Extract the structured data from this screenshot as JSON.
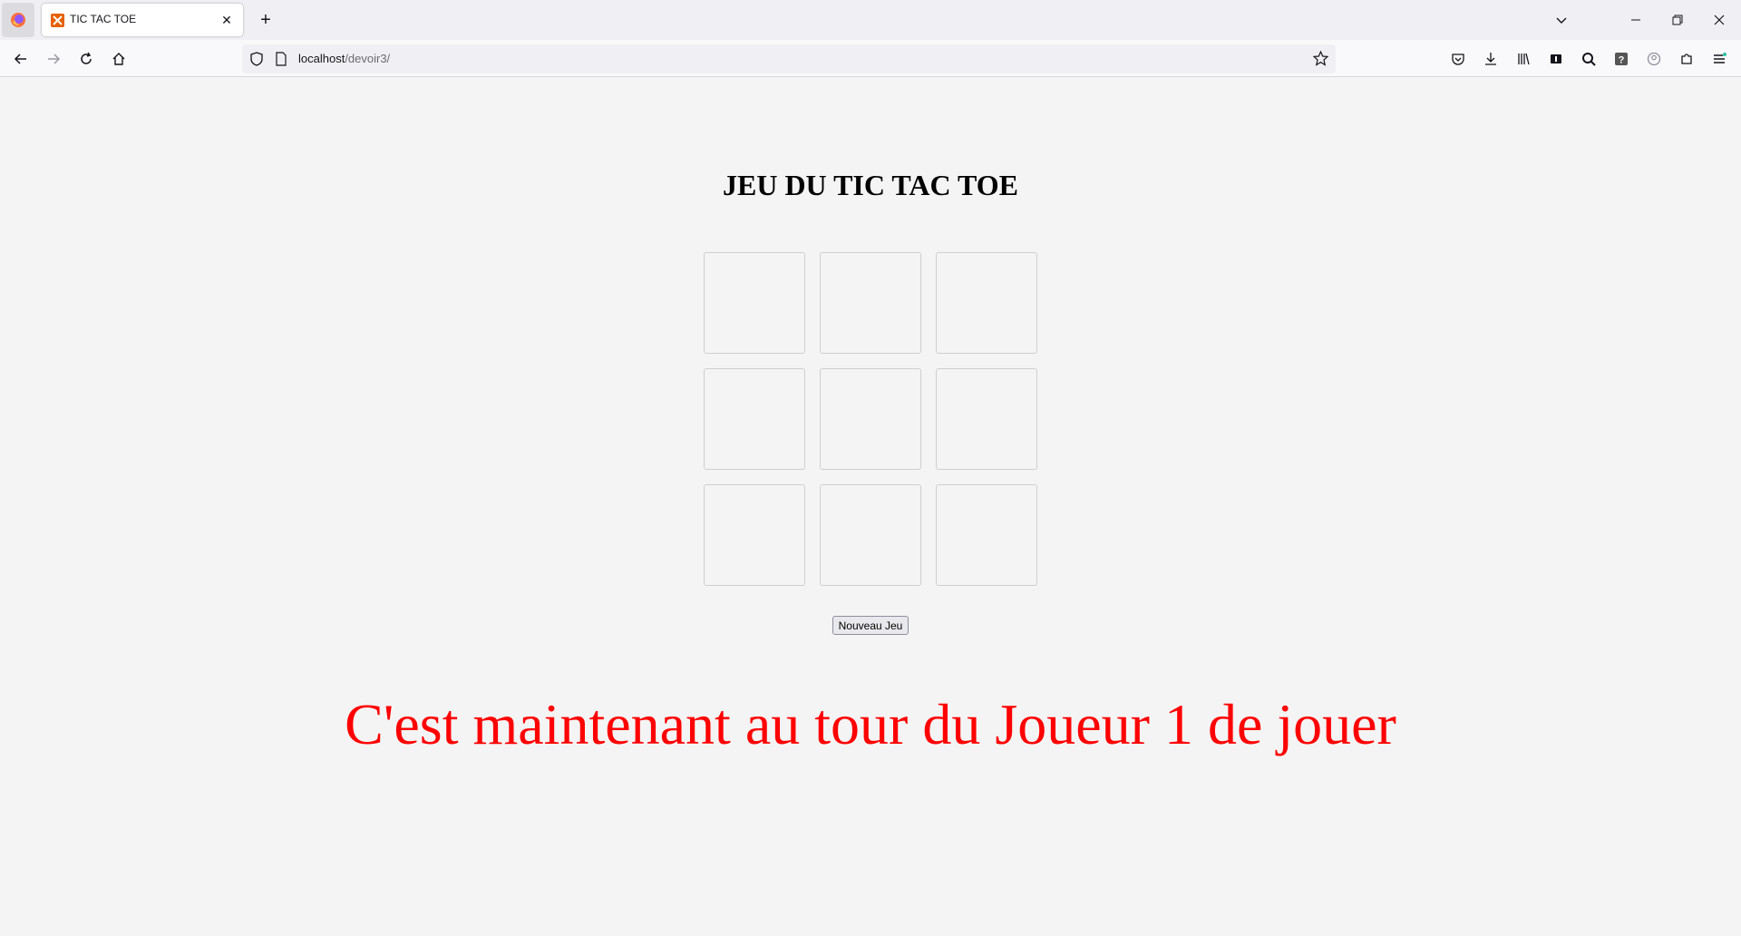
{
  "browser": {
    "tab": {
      "title": "TIC TAC TOE",
      "favicon": "xampp-icon"
    },
    "url": {
      "host": "localhost",
      "path": "/devoir3/"
    },
    "toolbar_icons": [
      "pocket-icon",
      "download-icon",
      "library-icon",
      "extension-icon",
      "search-icon",
      "help-icon",
      "account-icon",
      "extensions-puzzle-icon",
      "menu-icon"
    ]
  },
  "page": {
    "title": "JEU DU TIC TAC TOE",
    "board": {
      "cells": [
        "",
        "",
        "",
        "",
        "",
        "",
        "",
        "",
        ""
      ]
    },
    "new_game_label": "Nouveau Jeu",
    "status_text": "C'est maintenant au tour du Joueur 1 de jouer",
    "status_color": "#ff0000"
  }
}
